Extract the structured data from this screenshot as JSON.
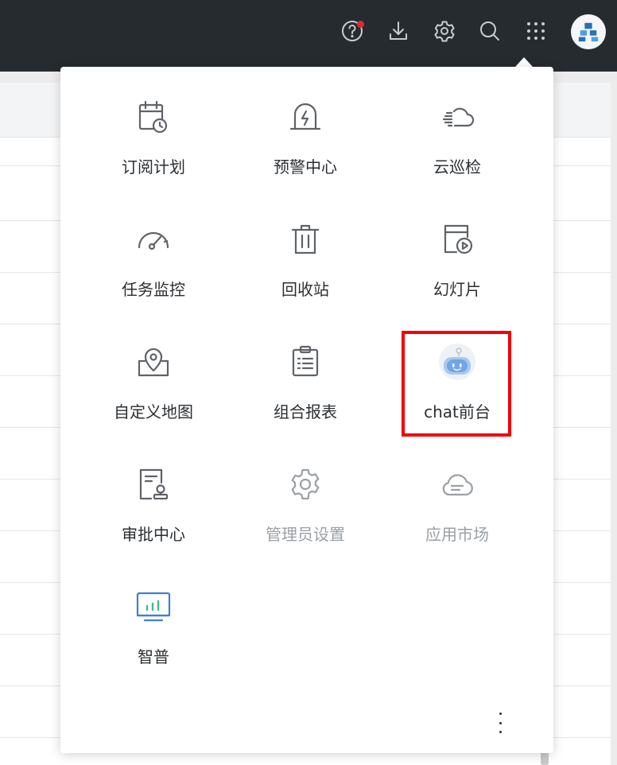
{
  "topbar": {
    "icons": [
      "help-icon",
      "download-icon",
      "settings-icon",
      "search-icon",
      "app-grid-icon"
    ],
    "help_badge_color": "#e02b2b",
    "avatar": "avatar-logo"
  },
  "apps": [
    {
      "label": "订阅计划",
      "icon": "calendar-clock-icon",
      "enabled": true
    },
    {
      "label": "预警中心",
      "icon": "alarm-bell-icon",
      "enabled": true
    },
    {
      "label": "云巡检",
      "icon": "cloud-fast-icon",
      "enabled": true
    },
    {
      "label": "任务监控",
      "icon": "gauge-icon",
      "enabled": true
    },
    {
      "label": "回收站",
      "icon": "trash-icon",
      "enabled": true
    },
    {
      "label": "幻灯片",
      "icon": "slideshow-play-icon",
      "enabled": true
    },
    {
      "label": "自定义地图",
      "icon": "map-pin-icon",
      "enabled": true
    },
    {
      "label": "组合报表",
      "icon": "clipboard-report-icon",
      "enabled": true
    },
    {
      "label": "chat前台",
      "icon": "chat-robot-icon",
      "enabled": true,
      "highlighted": true
    },
    {
      "label": "审批中心",
      "icon": "approval-stamp-icon",
      "enabled": true
    },
    {
      "label": "管理员设置",
      "icon": "admin-gear-icon",
      "enabled": false
    },
    {
      "label": "应用市场",
      "icon": "cloud-market-icon",
      "enabled": false
    },
    {
      "label": "智普",
      "icon": "monitor-chart-icon",
      "enabled": true
    }
  ],
  "highlight_color": "#f50000",
  "more_menu_icon": "more-vertical-icon"
}
